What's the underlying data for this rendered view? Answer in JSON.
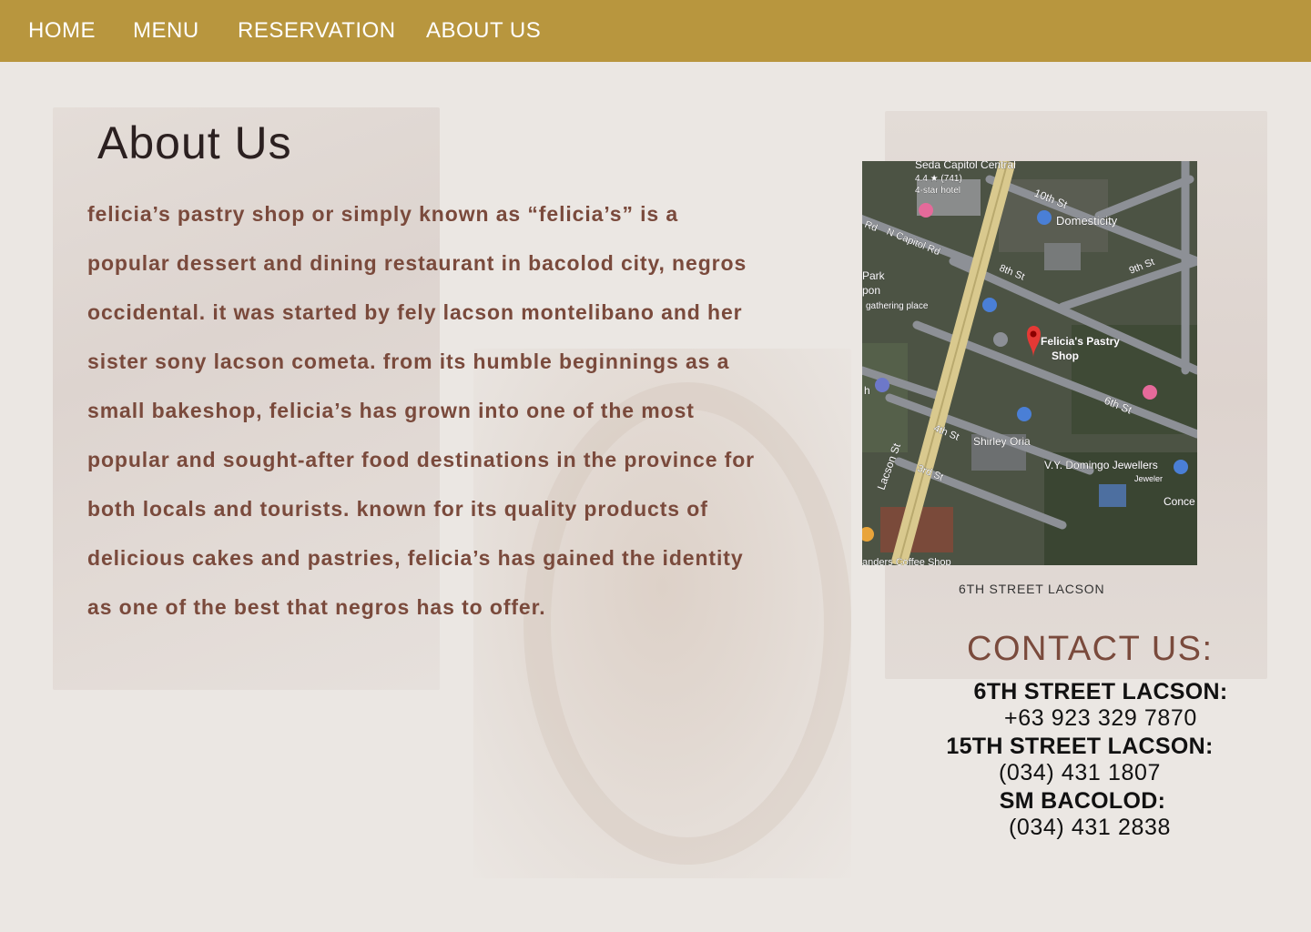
{
  "nav": {
    "home": "HOME",
    "menu": "MENU",
    "reservation": "RESERVATION",
    "about": "ABOUT US"
  },
  "about": {
    "title": "About Us",
    "body": "felicia’s pastry shop or simply known as “felicia’s” is a popular dessert and dining restaurant in bacolod city, negros occidental. it was started by fely lacson montelibano and her sister sony lacson cometa. from its humble beginnings as a small bakeshop, felicia’s has grown into one of the most popular and sought-after food destinations in the province for both locals and tourists. known for its quality products of delicious cakes and pastries, felicia’s has gained the identity as one of the best that negros has to offer."
  },
  "map": {
    "caption": "6TH STREET LACSON",
    "labels": {
      "hotel": "Seda Capitol Central",
      "hotel_rating": "4.4 ★ (741)",
      "hotel_type": "4-star hotel",
      "street_10th": "10th St",
      "domesticity": "Domesticity",
      "capitol_rd": "N Capitol Rd",
      "rd": "Rd",
      "street_8th": "8th St",
      "street_9th": "9th St",
      "park": "Park",
      "pon": "pon",
      "gathering": "gathering place",
      "felicias_line1": "Felicia's Pastry",
      "felicias_line2": "Shop",
      "street_6th": "6th St",
      "street_4th": "4th St",
      "shirley": "Shirley Oria",
      "lacson_st": "Lacson St",
      "street_3rd": "3rd St",
      "domingo": "V.Y. Domingo Jewellers",
      "jeweler": "Jeweler",
      "conce": "Conce",
      "coffee": "anders Coffee Shop",
      "h": "h"
    }
  },
  "contact": {
    "title": "CONTACT US:",
    "entries": [
      {
        "label": "6TH STREET LACSON:",
        "phone": "+63 923 329 7870"
      },
      {
        "label": "15TH STREET LACSON:",
        "phone": "(034) 431 1807"
      },
      {
        "label": "SM BACOLOD:",
        "phone": "(034) 431 2838"
      }
    ]
  },
  "colors": {
    "nav_bg": "#b8963e",
    "body_text": "#7a4a3c",
    "page_bg": "#ebe7e3"
  }
}
